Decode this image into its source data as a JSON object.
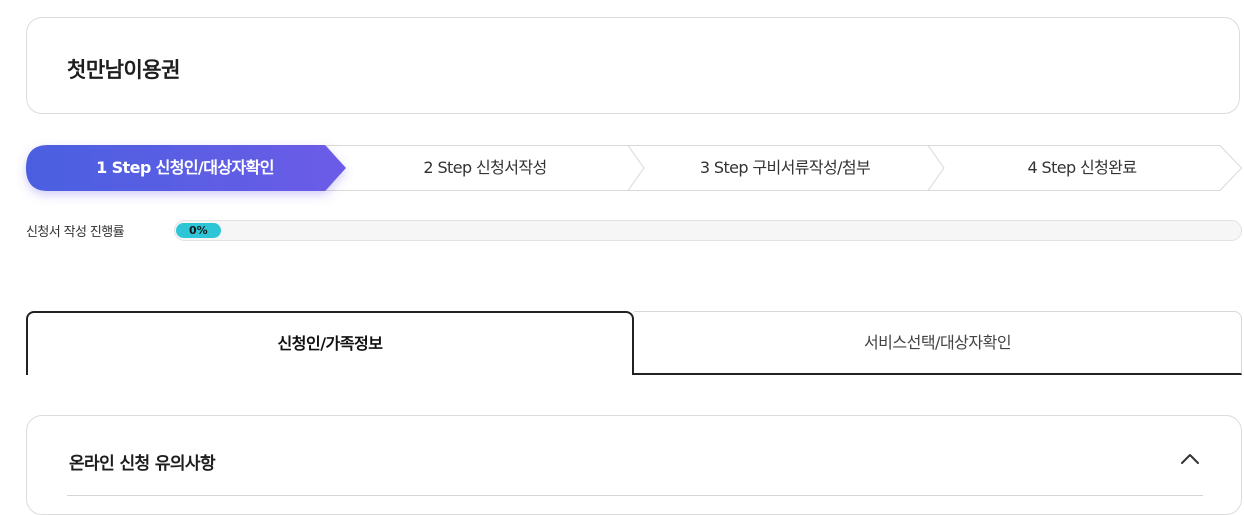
{
  "page": {
    "title": "첫만남이용권"
  },
  "steps": [
    {
      "label": "1 Step 신청인/대상자확인",
      "active": true
    },
    {
      "label": "2 Step 신청서작성",
      "active": false
    },
    {
      "label": "3 Step 구비서류작성/첨부",
      "active": false
    },
    {
      "label": "4 Step 신청완료",
      "active": false
    }
  ],
  "progress": {
    "label": "신청서 작성 진행률",
    "value_text": "0%",
    "value": 0
  },
  "tabs": [
    {
      "label": "신청인/가족정보",
      "active": true
    },
    {
      "label": "서비스선택/대상자확인",
      "active": false
    }
  ],
  "notice": {
    "title": "온라인 신청 유의사항",
    "expanded": true,
    "toggle_icon": "chevron-up-icon"
  },
  "colors": {
    "active_step_gradient_start": "#4a5fe0",
    "active_step_gradient_end": "#6c5ce7",
    "progress_fill": "#2ec6d6",
    "border": "#dcdcdc"
  }
}
